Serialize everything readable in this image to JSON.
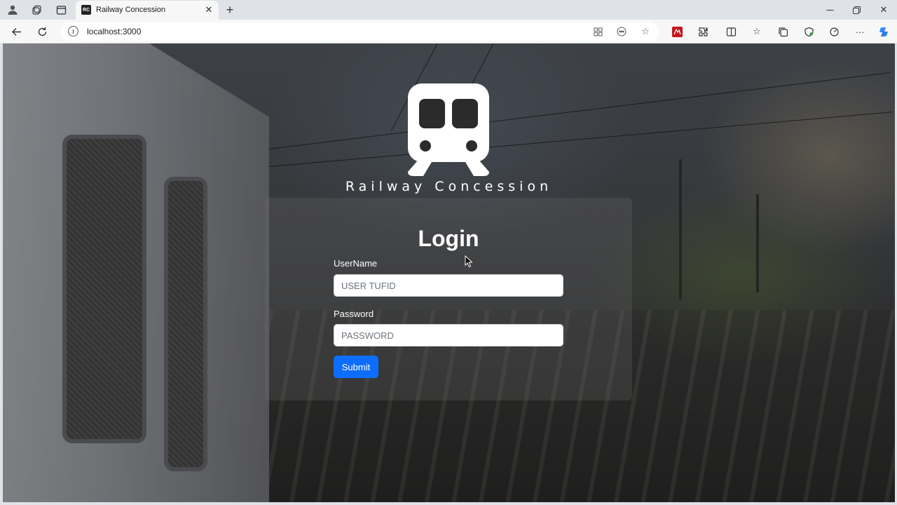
{
  "browser": {
    "tab": {
      "favicon_text": "RC",
      "title": "Railway Concession"
    },
    "address": "localhost:3000"
  },
  "page": {
    "brand": "Railway Concession",
    "login": {
      "title": "Login",
      "username_label": "UserName",
      "username_placeholder": "USER TUFID",
      "username_value": "",
      "password_label": "Password",
      "password_placeholder": "PASSWORD",
      "password_value": "",
      "submit_label": "Submit"
    }
  },
  "colors": {
    "primary_button": "#0d6efd",
    "text_light": "#ffffff"
  }
}
